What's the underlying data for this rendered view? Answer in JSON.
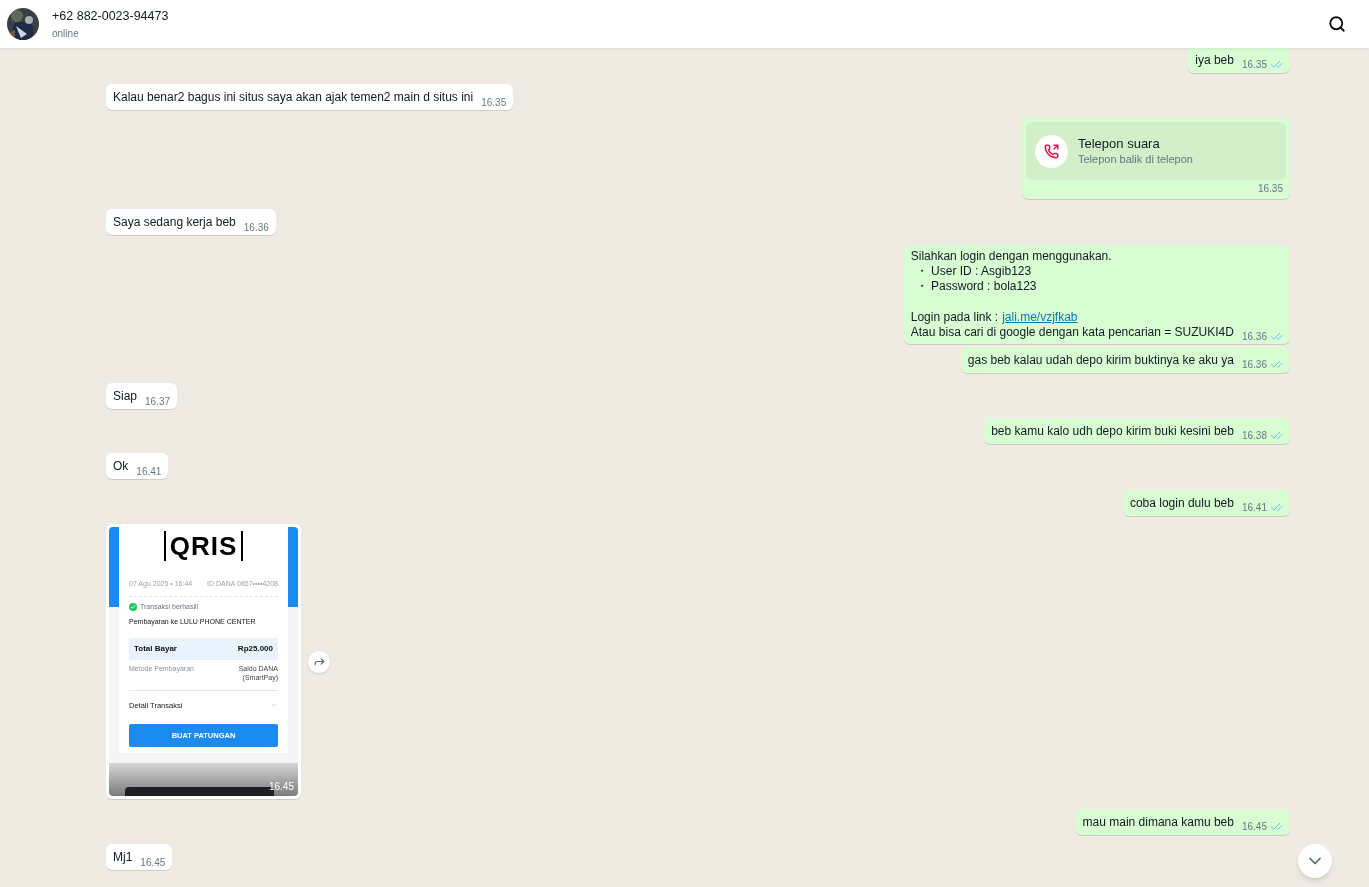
{
  "contact": {
    "name": "+62 882-0023-94473",
    "status": "online"
  },
  "messages": [
    {
      "kind": "text",
      "outgoing": true,
      "text": "iya beb",
      "time": "16.35",
      "read": true
    },
    {
      "kind": "text",
      "outgoing": false,
      "text": "Kalau benar2 bagus ini situs saya akan ajak temen2 main d situs ini",
      "time": "16.35"
    },
    {
      "kind": "call",
      "outgoing": true,
      "title": "Telepon suara",
      "subtitle": "Telepon balik di telepon",
      "time": "16.35"
    },
    {
      "kind": "text",
      "outgoing": false,
      "text": "Saya sedang kerja beb",
      "time": "16.36"
    },
    {
      "kind": "login",
      "outgoing": true,
      "intro": "Silahkan login dengan menggunakan.",
      "bullets": [
        "・ User ID : Asgib123",
        "・ Password : bola123"
      ],
      "link_label": "Login pada link :",
      "link": "jali.me/vzjfkab",
      "outro": "Atau bisa cari di google dengan kata pencarian = SUZUKI4D",
      "time": "16.36",
      "read": true
    },
    {
      "kind": "text",
      "outgoing": true,
      "text": "gas beb kalau udah depo kirim buktinya ke aku ya",
      "time": "16.36",
      "read": true
    },
    {
      "kind": "text",
      "outgoing": false,
      "text": "Siap",
      "time": "16.37"
    },
    {
      "kind": "text",
      "outgoing": true,
      "text": "beb kamu kalo udh depo kirim buki kesini beb",
      "time": "16.38",
      "read": true
    },
    {
      "kind": "text",
      "outgoing": false,
      "text": "Ok",
      "time": "16.41"
    },
    {
      "kind": "text",
      "outgoing": true,
      "text": "coba login dulu beb",
      "time": "16.41",
      "read": true
    },
    {
      "outgoing": false,
      "time": "16.45",
      "receipt": {
        "logo": "QRIS",
        "date": "07 Agu 2025 • 16:44",
        "account": "ID DANA 0857••••4208",
        "status": "Transaksi berhasil!",
        "payee": "Pembayaran ke LULU PHONE CENTER",
        "total_label": "Total Bayar",
        "total": "Rp25.000",
        "method_label": "Metode Pembayaran",
        "method": "Saldo DANA (SmartPay)",
        "detail": "Detail Transaksi",
        "button": "BUAT PATUNGAN"
      }
    },
    {
      "kind": "text",
      "outgoing": true,
      "text": "mau main dimana kamu beb",
      "time": "16.45",
      "read": true
    },
    {
      "kind": "text",
      "outgoing": false,
      "text": "Mj1",
      "time": "16.45"
    }
  ]
}
